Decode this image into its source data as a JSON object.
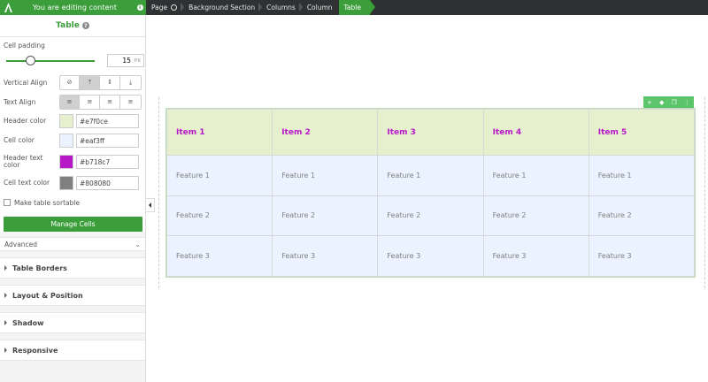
{
  "topbar": {
    "editing_label": "You are editing content",
    "info_icon": "info-icon",
    "logo_icon": "app-logo-icon"
  },
  "breadcrumb": [
    "Page",
    "Background Section",
    "Columns",
    "Column",
    "Table"
  ],
  "panel": {
    "title": "Table",
    "cell_padding": {
      "label": "Cell padding",
      "value": "15",
      "unit": "PX",
      "slider_fraction": 0.15
    },
    "vertical_align": {
      "label": "Vertical Align",
      "options": [
        "none-icon",
        "align-top-icon",
        "align-middle-icon",
        "align-bottom-icon"
      ],
      "selected": 1
    },
    "text_align": {
      "label": "Text Align",
      "options": [
        "align-left-icon",
        "align-center-icon",
        "align-right-icon",
        "align-justify-icon"
      ],
      "selected": 0
    },
    "colors": [
      {
        "label": "Header color",
        "value": "#e7f0ce",
        "swatch": "#e7f0ce"
      },
      {
        "label": "Cell color",
        "value": "#eaf3ff",
        "swatch": "#eaf3ff"
      },
      {
        "label": "Header text color",
        "value": "#b718c7",
        "swatch": "#b718c7"
      },
      {
        "label": "Cell text color",
        "value": "#808080",
        "swatch": "#808080"
      }
    ],
    "sortable_label": "Make table sortable",
    "sortable_checked": false,
    "manage_button": "Manage Cells",
    "advanced_label": "Advanced",
    "sections": [
      "Table Borders",
      "Layout & Position",
      "Shadow",
      "Responsive"
    ]
  },
  "table": {
    "headers": [
      "Item 1",
      "Item 2",
      "Item 3",
      "Item 4",
      "Item 5"
    ],
    "rows": [
      [
        "Feature 1",
        "Feature 1",
        "Feature 1",
        "Feature 1",
        "Feature 1"
      ],
      [
        "Feature 2",
        "Feature 2",
        "Feature 2",
        "Feature 2",
        "Feature 2"
      ],
      [
        "Feature 3",
        "Feature 3",
        "Feature 3",
        "Feature 3",
        "Feature 3"
      ]
    ]
  },
  "toolbar_icons": [
    "add-icon",
    "paint-icon",
    "copy-icon",
    "more-icon"
  ],
  "accent_color": "#3b9e3b"
}
